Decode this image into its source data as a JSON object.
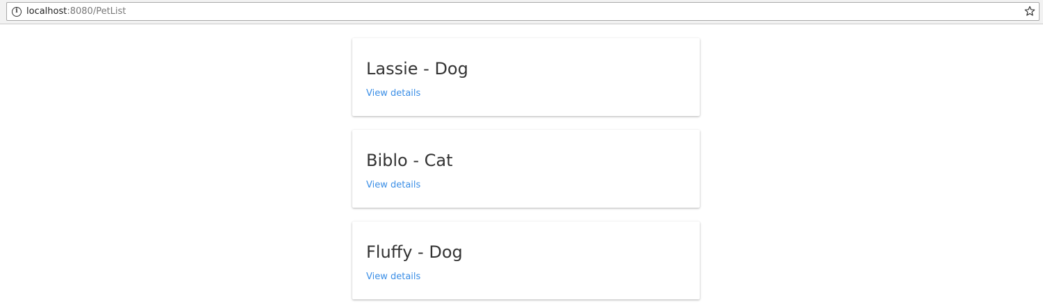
{
  "browser": {
    "url_host": "localhost",
    "url_rest": ":8080/PetList",
    "icons": {
      "info": "info-icon",
      "bookmark": "star-icon"
    }
  },
  "pets": [
    {
      "title": "Lassie - Dog",
      "link": "View details"
    },
    {
      "title": "Biblo - Cat",
      "link": "View details"
    },
    {
      "title": "Fluffy - Dog",
      "link": "View details"
    }
  ],
  "colors": {
    "link": "#3a8ee6",
    "title": "#333333"
  }
}
